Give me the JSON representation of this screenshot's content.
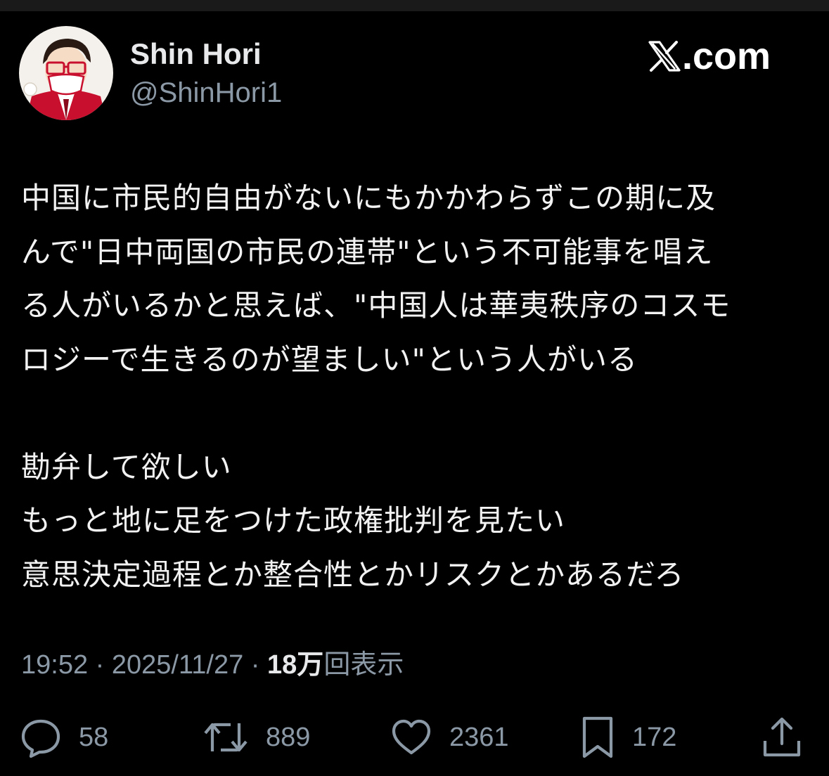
{
  "author": {
    "name": "Shin Hori",
    "handle": "@ShinHori1",
    "avatar_icon": "illustrated-avatar-masked-man"
  },
  "brand": {
    "logo_icon": "x-logo-icon",
    "text": ".com"
  },
  "tweet": {
    "lines": [
      "中国に市民的自由がないにもかかわらずこの期に及",
      "んで\"日中両国の市民の連帯\"という不可能事を唱え",
      "る人がいるかと思えば、\"中国人は華夷秩序のコスモ",
      "ロジーで生きるのが望ましい\"という人がいる",
      "",
      "勘弁して欲しい",
      "もっと地に足をつけた政権批判を見たい",
      "意思決定過程とか整合性とかリスクとかあるだろ"
    ]
  },
  "meta": {
    "time": "19:52",
    "separator": " · ",
    "date": "2025/11/27",
    "views_count": "18万",
    "views_label": "回表示"
  },
  "actions": {
    "replies": "58",
    "reposts": "889",
    "likes": "2361",
    "bookmarks": "172"
  },
  "colors": {
    "background": "#000000",
    "text_primary": "#e7e9ea",
    "text_secondary": "#8b98a5",
    "avatar_accent": "#c8102e"
  }
}
